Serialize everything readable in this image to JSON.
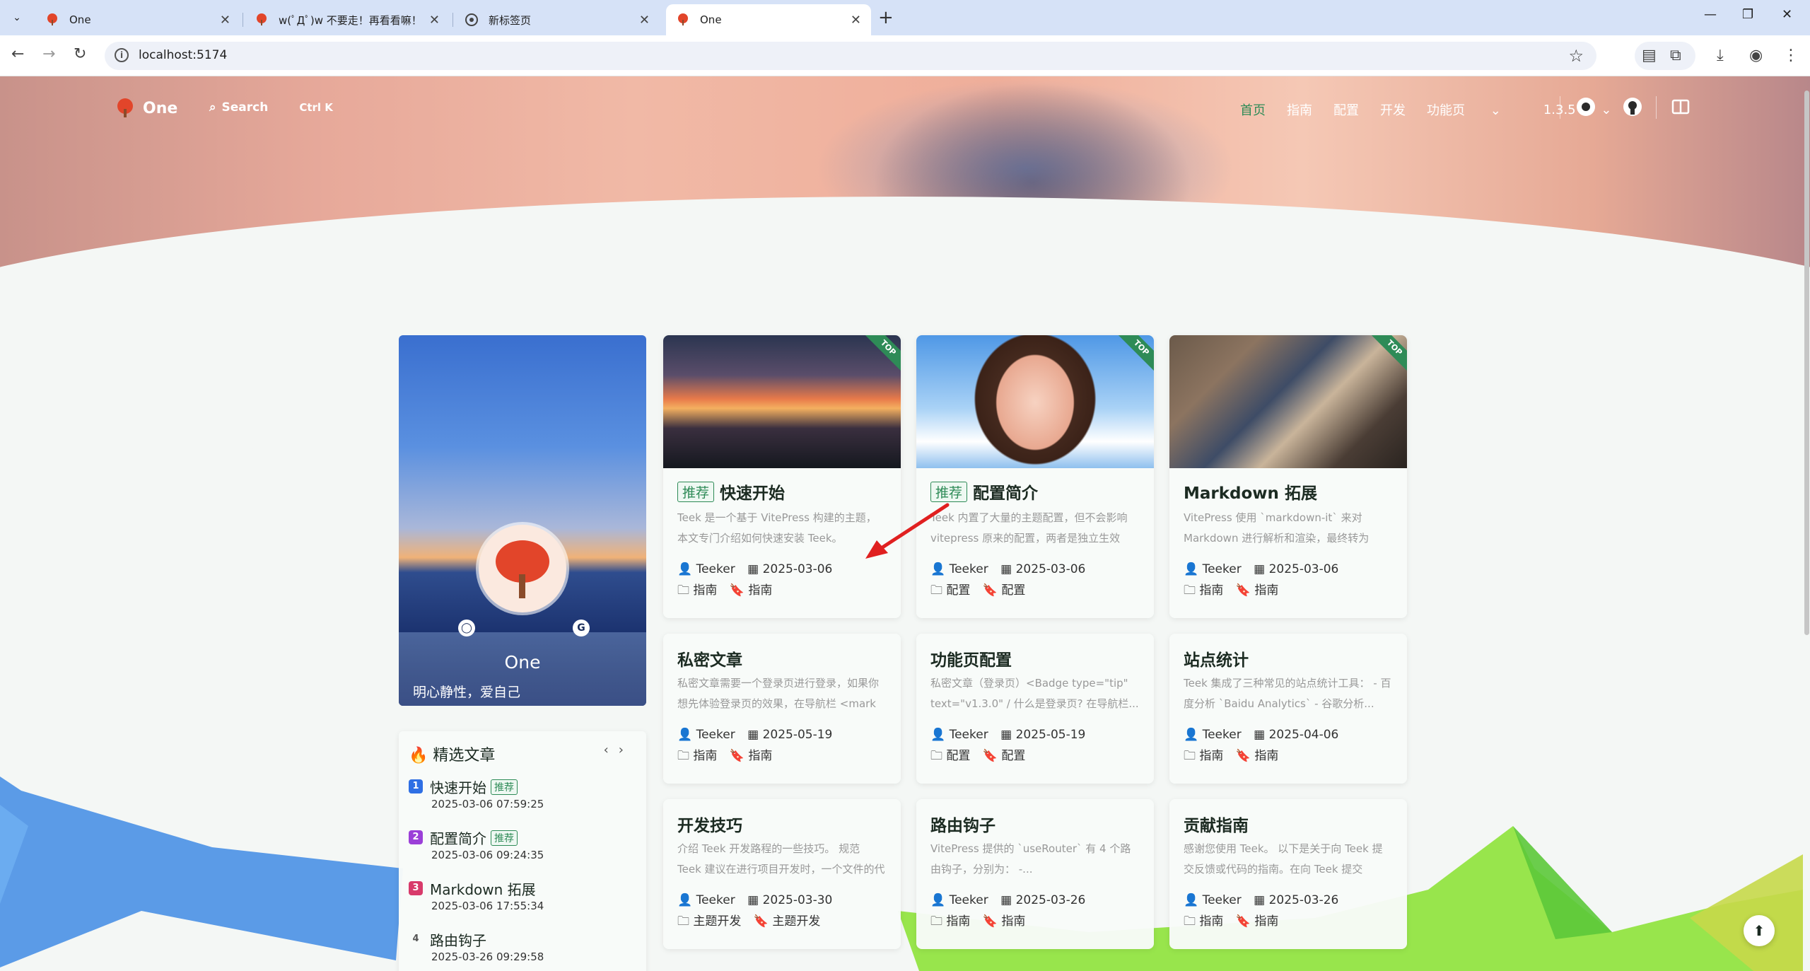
{
  "browser": {
    "tabs": [
      {
        "title": "One",
        "active": false
      },
      {
        "title": "w(ﾟДﾟ)w 不要走！再看看嘛！",
        "active": false
      },
      {
        "title": "新标签页",
        "active": false
      },
      {
        "title": "One",
        "active": true
      }
    ],
    "url": "localhost:5174"
  },
  "site": {
    "brand": "One",
    "search_label": "Search",
    "search_shortcut": "Ctrl K",
    "nav": [
      "首页",
      "指南",
      "配置",
      "开发",
      "功能页",
      "1.3.5"
    ],
    "nav_active": "首页",
    "accent": "#2e8b57"
  },
  "profile": {
    "name": "One",
    "motto": "明心静性，爱自己"
  },
  "featured": {
    "heading": "精选文章",
    "items": [
      {
        "num": "1",
        "title": "快速开始",
        "badge": "推荐",
        "date": "2025-03-06 07:59:25",
        "color": "#2f6fe4"
      },
      {
        "num": "2",
        "title": "配置简介",
        "badge": "推荐",
        "date": "2025-03-06 09:24:35",
        "color": "#9b3fd8"
      },
      {
        "num": "3",
        "title": "Markdown 拓展",
        "badge": "",
        "date": "2025-03-06 17:55:34",
        "color": "#d83a6b"
      },
      {
        "num": "4",
        "title": "路由钩子",
        "badge": "",
        "date": "2025-03-26 09:29:58",
        "color": ""
      }
    ]
  },
  "posts": [
    {
      "badge": "推荐",
      "title": "快速开始",
      "desc": "Teek 是一个基于 VitePress 构建的主题，本文专门介绍如何快速安装 Teek。",
      "author": "Teeker",
      "date": "2025-03-06",
      "category": "指南",
      "tag": "指南",
      "top": "TOP"
    },
    {
      "badge": "推荐",
      "title": "配置简介",
      "desc": "Teek 内置了大量的主题配置，但不会影响 vitepress 原来的配置，两者是独立生效的...",
      "author": "Teeker",
      "date": "2025-03-06",
      "category": "配置",
      "tag": "配置",
      "top": "TOP"
    },
    {
      "badge": "",
      "title": "Markdown 拓展",
      "desc": "VitePress 使用 `markdown-it` 来对 Markdown 进行解析和渲染，最终转为 Vu...",
      "author": "Teeker",
      "date": "2025-03-06",
      "category": "指南",
      "tag": "指南",
      "top": "TOP"
    },
    {
      "badge": "",
      "title": "私密文章",
      "desc": "私密文章需要一个登录页进行登录，如果你想先体验登录页的效果，在导航栏 <mark ...",
      "author": "Teeker",
      "date": "2025-05-19",
      "category": "指南",
      "tag": "指南",
      "top": ""
    },
    {
      "badge": "",
      "title": "功能页配置",
      "desc": "私密文章（登录页）<Badge type=\"tip\" text=\"v1.3.0\" / 什么是登录页? 在导航栏...",
      "author": "Teeker",
      "date": "2025-05-19",
      "category": "配置",
      "tag": "配置",
      "top": ""
    },
    {
      "badge": "",
      "title": "站点统计",
      "desc": "Teek 集成了三种常见的站点统计工具： - 百度分析 `Baidu Analytics` - 谷歌分析...",
      "author": "Teeker",
      "date": "2025-04-06",
      "category": "指南",
      "tag": "指南",
      "top": ""
    },
    {
      "badge": "",
      "title": "开发技巧",
      "desc": "介绍 Teek 开发路程的一些技巧。 规范 Teek 建议在进行项目开发时，一个文件的代码行...",
      "author": "Teeker",
      "date": "2025-03-30",
      "category": "主题开发",
      "tag": "主题开发",
      "top": ""
    },
    {
      "badge": "",
      "title": "路由钩子",
      "desc": "VitePress 提供的 `useRouter` 有 4 个路由钩子，分别为： -...",
      "author": "Teeker",
      "date": "2025-03-26",
      "category": "指南",
      "tag": "指南",
      "top": ""
    },
    {
      "badge": "",
      "title": "贡献指南",
      "desc": "感谢您使用 Teek。 以下是关于向 Teek 提交反馈或代码的指南。在向 Teek 提交 Issue...",
      "author": "Teeker",
      "date": "2025-03-26",
      "category": "指南",
      "tag": "指南",
      "top": ""
    }
  ]
}
